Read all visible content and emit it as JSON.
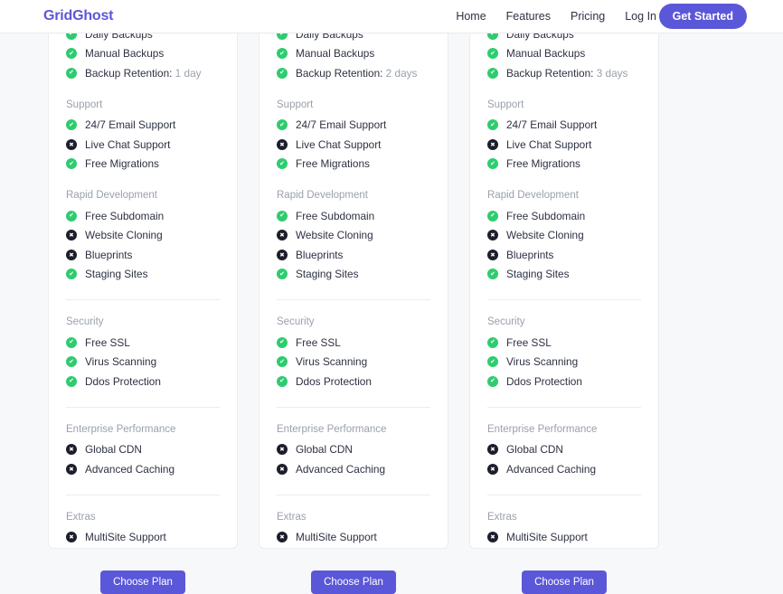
{
  "header": {
    "logo": "GridGhost",
    "nav": [
      {
        "label": "Home",
        "name": "nav-link-home"
      },
      {
        "label": "Features",
        "name": "nav-link-features"
      },
      {
        "label": "Pricing",
        "name": "nav-link-pricing"
      },
      {
        "label": "Log In",
        "name": "nav-link-login"
      }
    ],
    "cta_label": "Get Started"
  },
  "colors": {
    "brand": "#5b57d9",
    "included": "#2ecc6f",
    "excluded": "#1c1e2b",
    "page_bg": "#f7f8f9",
    "card_bg": "#ffffff",
    "muted_text": "#9aa0ac",
    "body_text": "#2d3142",
    "divider": "#ececf0"
  },
  "icons": {
    "included": "check-circle-icon",
    "excluded": "x-circle-icon"
  },
  "plans": [
    {
      "name": "plan-column-1",
      "choose_label": "Choose Plan",
      "groups": [
        {
          "heading": null,
          "features": [
            {
              "label": "Daily Backups",
              "value": "",
              "included": true
            },
            {
              "label": "Manual Backups",
              "value": "",
              "included": true
            },
            {
              "label": "Backup Retention:",
              "value": "1 day",
              "included": true
            }
          ]
        },
        {
          "heading": "Support",
          "features": [
            {
              "label": "24/7 Email Support",
              "value": "",
              "included": true
            },
            {
              "label": "Live Chat Support",
              "value": "",
              "included": false
            },
            {
              "label": "Free Migrations",
              "value": "",
              "included": true
            }
          ]
        },
        {
          "heading": "Rapid Development",
          "features": [
            {
              "label": "Free Subdomain",
              "value": "",
              "included": true
            },
            {
              "label": "Website Cloning",
              "value": "",
              "included": false
            },
            {
              "label": "Blueprints",
              "value": "",
              "included": false
            },
            {
              "label": "Staging Sites",
              "value": "",
              "included": true
            }
          ]
        },
        {
          "heading": "Security",
          "divider_above": true,
          "features": [
            {
              "label": "Free SSL",
              "value": "",
              "included": true
            },
            {
              "label": "Virus Scanning",
              "value": "",
              "included": true
            },
            {
              "label": "Ddos Protection",
              "value": "",
              "included": true
            }
          ]
        },
        {
          "heading": "Enterprise Performance",
          "divider_above": true,
          "features": [
            {
              "label": "Global CDN",
              "value": "",
              "included": false
            },
            {
              "label": "Advanced Caching",
              "value": "",
              "included": false
            }
          ]
        },
        {
          "heading": "Extras",
          "divider_above": true,
          "features": [
            {
              "label": "MultiSite Support",
              "value": "",
              "included": false
            }
          ]
        }
      ]
    },
    {
      "name": "plan-column-2",
      "choose_label": "Choose Plan",
      "groups": [
        {
          "heading": null,
          "features": [
            {
              "label": "Daily Backups",
              "value": "",
              "included": true
            },
            {
              "label": "Manual Backups",
              "value": "",
              "included": true
            },
            {
              "label": "Backup Retention:",
              "value": "2 days",
              "included": true
            }
          ]
        },
        {
          "heading": "Support",
          "features": [
            {
              "label": "24/7 Email Support",
              "value": "",
              "included": true
            },
            {
              "label": "Live Chat Support",
              "value": "",
              "included": false
            },
            {
              "label": "Free Migrations",
              "value": "",
              "included": true
            }
          ]
        },
        {
          "heading": "Rapid Development",
          "features": [
            {
              "label": "Free Subdomain",
              "value": "",
              "included": true
            },
            {
              "label": "Website Cloning",
              "value": "",
              "included": false
            },
            {
              "label": "Blueprints",
              "value": "",
              "included": false
            },
            {
              "label": "Staging Sites",
              "value": "",
              "included": true
            }
          ]
        },
        {
          "heading": "Security",
          "divider_above": true,
          "features": [
            {
              "label": "Free SSL",
              "value": "",
              "included": true
            },
            {
              "label": "Virus Scanning",
              "value": "",
              "included": true
            },
            {
              "label": "Ddos Protection",
              "value": "",
              "included": true
            }
          ]
        },
        {
          "heading": "Enterprise Performance",
          "divider_above": true,
          "features": [
            {
              "label": "Global CDN",
              "value": "",
              "included": false
            },
            {
              "label": "Advanced Caching",
              "value": "",
              "included": false
            }
          ]
        },
        {
          "heading": "Extras",
          "divider_above": true,
          "features": [
            {
              "label": "MultiSite Support",
              "value": "",
              "included": false
            }
          ]
        }
      ]
    },
    {
      "name": "plan-column-3",
      "choose_label": "Choose Plan",
      "groups": [
        {
          "heading": null,
          "features": [
            {
              "label": "Daily Backups",
              "value": "",
              "included": true
            },
            {
              "label": "Manual Backups",
              "value": "",
              "included": true
            },
            {
              "label": "Backup Retention:",
              "value": "3 days",
              "included": true
            }
          ]
        },
        {
          "heading": "Support",
          "features": [
            {
              "label": "24/7 Email Support",
              "value": "",
              "included": true
            },
            {
              "label": "Live Chat Support",
              "value": "",
              "included": false
            },
            {
              "label": "Free Migrations",
              "value": "",
              "included": true
            }
          ]
        },
        {
          "heading": "Rapid Development",
          "features": [
            {
              "label": "Free Subdomain",
              "value": "",
              "included": true
            },
            {
              "label": "Website Cloning",
              "value": "",
              "included": false
            },
            {
              "label": "Blueprints",
              "value": "",
              "included": false
            },
            {
              "label": "Staging Sites",
              "value": "",
              "included": true
            }
          ]
        },
        {
          "heading": "Security",
          "divider_above": true,
          "features": [
            {
              "label": "Free SSL",
              "value": "",
              "included": true
            },
            {
              "label": "Virus Scanning",
              "value": "",
              "included": true
            },
            {
              "label": "Ddos Protection",
              "value": "",
              "included": true
            }
          ]
        },
        {
          "heading": "Enterprise Performance",
          "divider_above": true,
          "features": [
            {
              "label": "Global CDN",
              "value": "",
              "included": false
            },
            {
              "label": "Advanced Caching",
              "value": "",
              "included": false
            }
          ]
        },
        {
          "heading": "Extras",
          "divider_above": true,
          "features": [
            {
              "label": "MultiSite Support",
              "value": "",
              "included": false
            }
          ]
        }
      ]
    }
  ]
}
